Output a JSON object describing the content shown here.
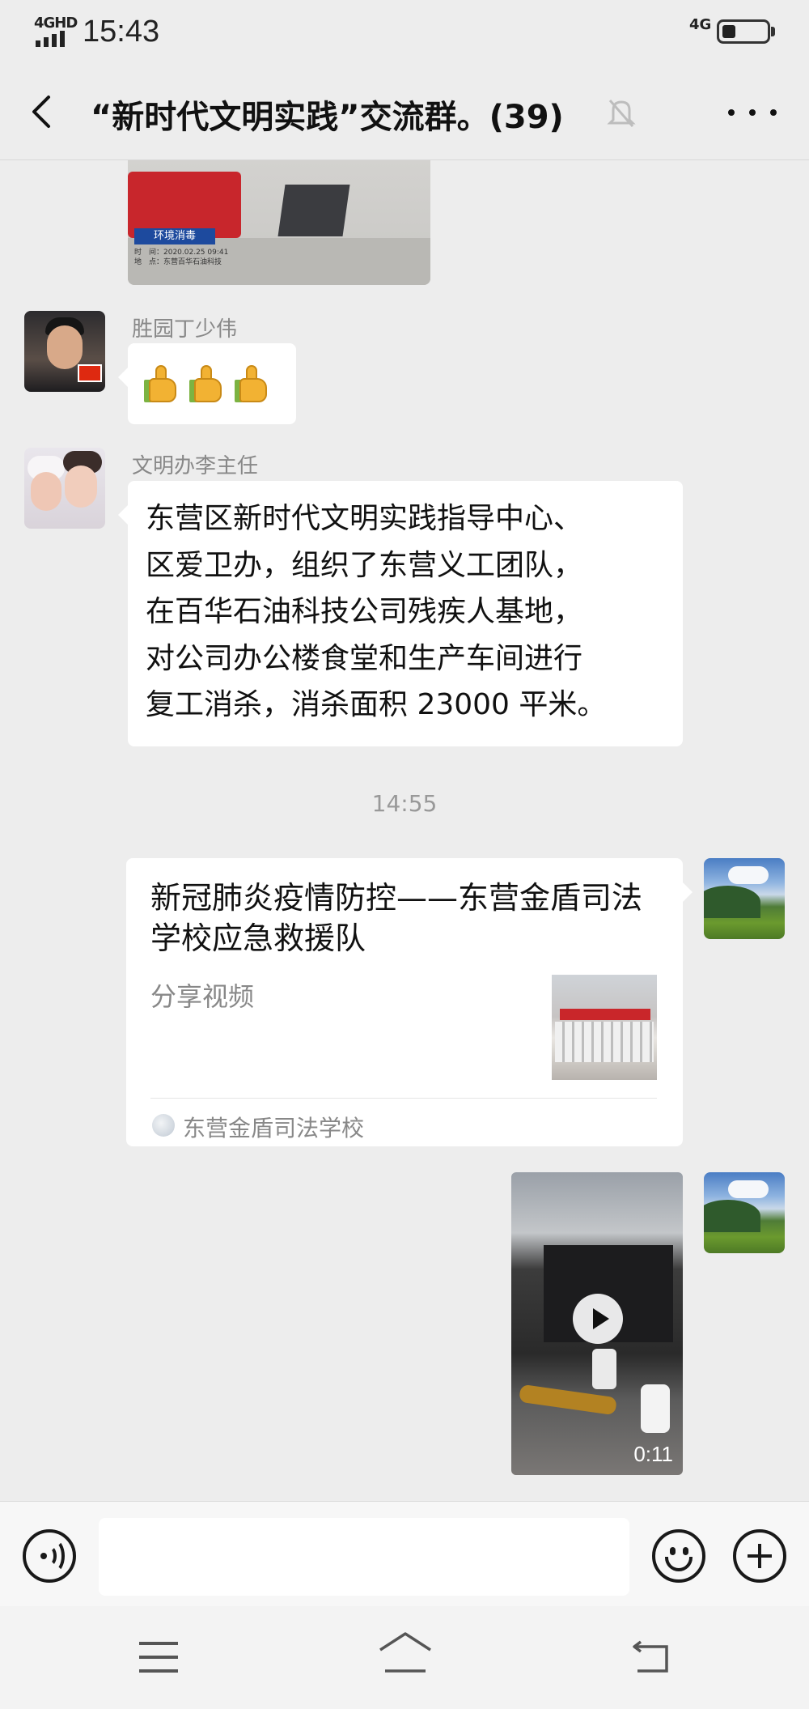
{
  "status_bar": {
    "network_label": "4GHD",
    "time": "15:43",
    "network_right": "4G",
    "battery_level": 0.3
  },
  "header": {
    "title": "“新时代文明实践”交流群。(39)",
    "back_icon": "chevron-left-icon",
    "mute_icon": "bell-muted-icon",
    "more_icon": "more-dots-icon"
  },
  "messages": {
    "m1": {
      "sender": "胜园丁少伟",
      "emoji": "thumbs-up-icon x3"
    },
    "m2": {
      "sender": "文明办李主任",
      "lines": [
        "东营区新时代文明实践指导中心、",
        "区爱卫办，组织了东营义工团队，",
        "在百华石油科技公司残疾人基地，",
        "对公司办公楼食堂和生产车间进行",
        "复工消杀，消杀面积 23000 平米。"
      ]
    },
    "time_separator": "14:55",
    "card": {
      "title": "新冠肺炎疫情防控——东营金盾司法学校应急救援队",
      "subtitle": "分享视频",
      "source": "东营金盾司法学校"
    },
    "video": {
      "duration": "0:11"
    }
  },
  "input_bar": {
    "placeholder": "",
    "voice_icon": "voice-icon",
    "emoji_icon": "emoji-icon",
    "plus_icon": "plus-icon"
  },
  "system_nav": {
    "menu_icon": "menu-icon",
    "home_icon": "home-icon",
    "back_icon": "back-icon"
  }
}
